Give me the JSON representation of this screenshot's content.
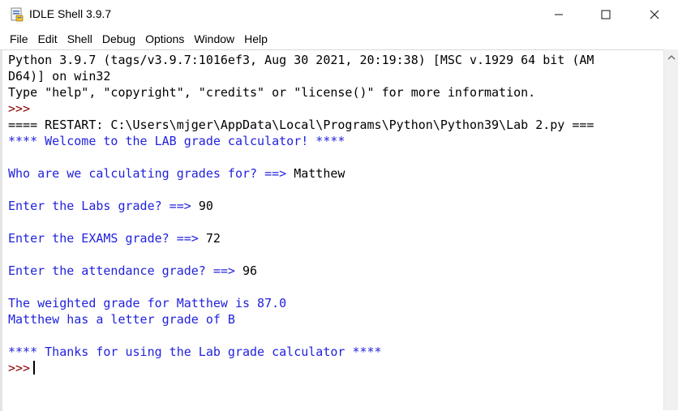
{
  "window": {
    "title": "IDLE Shell 3.9.7",
    "icon": "python-idle-icon",
    "controls": {
      "minimize": "—",
      "maximize": "☐",
      "close": "✕"
    }
  },
  "menu": [
    {
      "id": "file",
      "label": "File"
    },
    {
      "id": "edit",
      "label": "Edit"
    },
    {
      "id": "shell",
      "label": "Shell"
    },
    {
      "id": "debug",
      "label": "Debug"
    },
    {
      "id": "options",
      "label": "Options"
    },
    {
      "id": "window",
      "label": "Window"
    },
    {
      "id": "help",
      "label": "Help"
    }
  ],
  "shell": {
    "lines": [
      {
        "type": "out",
        "text": "Python 3.9.7 (tags/v3.9.7:1016ef3, Aug 30 2021, 20:19:38) [MSC v.1929 64 bit (AM"
      },
      {
        "type": "out",
        "text": "D64)] on win32"
      },
      {
        "type": "out",
        "text": "Type \"help\", \"copyright\", \"credits\" or \"license()\" for more information."
      },
      {
        "type": "prompt",
        "text": ">>> "
      },
      {
        "type": "out",
        "text": "==== RESTART: C:\\Users\\mjger\\AppData\\Local\\Programs\\Python\\Python39\\Lab 2.py ==="
      },
      {
        "type": "blue",
        "text": "**** Welcome to the LAB grade calculator! ****"
      },
      {
        "type": "blank",
        "text": ""
      },
      {
        "type": "ask",
        "text": "Who are we calculating grades for? ==> ",
        "input": "Matthew"
      },
      {
        "type": "blank",
        "text": ""
      },
      {
        "type": "ask",
        "text": "Enter the Labs grade? ==> ",
        "input": "90"
      },
      {
        "type": "blank",
        "text": ""
      },
      {
        "type": "ask",
        "text": "Enter the EXAMS grade? ==> ",
        "input": "72"
      },
      {
        "type": "blank",
        "text": ""
      },
      {
        "type": "ask",
        "text": "Enter the attendance grade? ==> ",
        "input": "96"
      },
      {
        "type": "blank",
        "text": ""
      },
      {
        "type": "blue",
        "text": "The weighted grade for Matthew is 87.0"
      },
      {
        "type": "blue",
        "text": "Matthew has a letter grade of B"
      },
      {
        "type": "blank",
        "text": ""
      },
      {
        "type": "blue",
        "text": "**** Thanks for using the Lab grade calculator ****"
      },
      {
        "type": "active-prompt",
        "text": ">>> "
      }
    ]
  },
  "colors": {
    "stdout": "#2222dd",
    "prompt": "#8b0000",
    "text": "#000000"
  }
}
